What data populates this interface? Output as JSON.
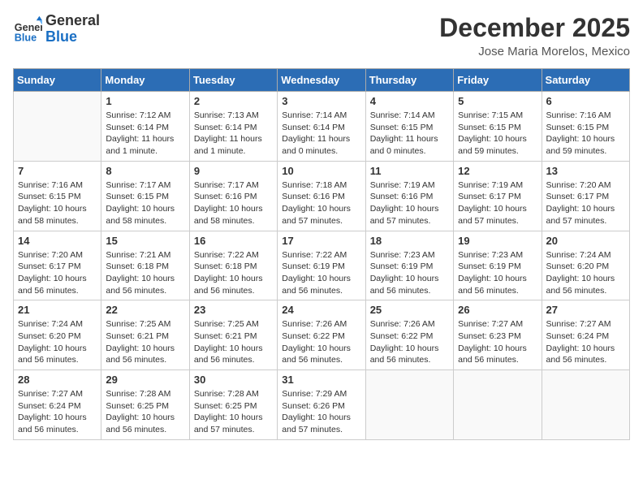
{
  "header": {
    "logo_general": "General",
    "logo_blue": "Blue",
    "month_title": "December 2025",
    "location": "Jose Maria Morelos, Mexico"
  },
  "columns": [
    "Sunday",
    "Monday",
    "Tuesday",
    "Wednesday",
    "Thursday",
    "Friday",
    "Saturday"
  ],
  "weeks": [
    [
      {
        "day": "",
        "info": ""
      },
      {
        "day": "1",
        "info": "Sunrise: 7:12 AM\nSunset: 6:14 PM\nDaylight: 11 hours and 1 minute."
      },
      {
        "day": "2",
        "info": "Sunrise: 7:13 AM\nSunset: 6:14 PM\nDaylight: 11 hours and 1 minute."
      },
      {
        "day": "3",
        "info": "Sunrise: 7:14 AM\nSunset: 6:14 PM\nDaylight: 11 hours and 0 minutes."
      },
      {
        "day": "4",
        "info": "Sunrise: 7:14 AM\nSunset: 6:15 PM\nDaylight: 11 hours and 0 minutes."
      },
      {
        "day": "5",
        "info": "Sunrise: 7:15 AM\nSunset: 6:15 PM\nDaylight: 10 hours and 59 minutes."
      },
      {
        "day": "6",
        "info": "Sunrise: 7:16 AM\nSunset: 6:15 PM\nDaylight: 10 hours and 59 minutes."
      }
    ],
    [
      {
        "day": "7",
        "info": "Sunrise: 7:16 AM\nSunset: 6:15 PM\nDaylight: 10 hours and 58 minutes."
      },
      {
        "day": "8",
        "info": "Sunrise: 7:17 AM\nSunset: 6:15 PM\nDaylight: 10 hours and 58 minutes."
      },
      {
        "day": "9",
        "info": "Sunrise: 7:17 AM\nSunset: 6:16 PM\nDaylight: 10 hours and 58 minutes."
      },
      {
        "day": "10",
        "info": "Sunrise: 7:18 AM\nSunset: 6:16 PM\nDaylight: 10 hours and 57 minutes."
      },
      {
        "day": "11",
        "info": "Sunrise: 7:19 AM\nSunset: 6:16 PM\nDaylight: 10 hours and 57 minutes."
      },
      {
        "day": "12",
        "info": "Sunrise: 7:19 AM\nSunset: 6:17 PM\nDaylight: 10 hours and 57 minutes."
      },
      {
        "day": "13",
        "info": "Sunrise: 7:20 AM\nSunset: 6:17 PM\nDaylight: 10 hours and 57 minutes."
      }
    ],
    [
      {
        "day": "14",
        "info": "Sunrise: 7:20 AM\nSunset: 6:17 PM\nDaylight: 10 hours and 56 minutes."
      },
      {
        "day": "15",
        "info": "Sunrise: 7:21 AM\nSunset: 6:18 PM\nDaylight: 10 hours and 56 minutes."
      },
      {
        "day": "16",
        "info": "Sunrise: 7:22 AM\nSunset: 6:18 PM\nDaylight: 10 hours and 56 minutes."
      },
      {
        "day": "17",
        "info": "Sunrise: 7:22 AM\nSunset: 6:19 PM\nDaylight: 10 hours and 56 minutes."
      },
      {
        "day": "18",
        "info": "Sunrise: 7:23 AM\nSunset: 6:19 PM\nDaylight: 10 hours and 56 minutes."
      },
      {
        "day": "19",
        "info": "Sunrise: 7:23 AM\nSunset: 6:19 PM\nDaylight: 10 hours and 56 minutes."
      },
      {
        "day": "20",
        "info": "Sunrise: 7:24 AM\nSunset: 6:20 PM\nDaylight: 10 hours and 56 minutes."
      }
    ],
    [
      {
        "day": "21",
        "info": "Sunrise: 7:24 AM\nSunset: 6:20 PM\nDaylight: 10 hours and 56 minutes."
      },
      {
        "day": "22",
        "info": "Sunrise: 7:25 AM\nSunset: 6:21 PM\nDaylight: 10 hours and 56 minutes."
      },
      {
        "day": "23",
        "info": "Sunrise: 7:25 AM\nSunset: 6:21 PM\nDaylight: 10 hours and 56 minutes."
      },
      {
        "day": "24",
        "info": "Sunrise: 7:26 AM\nSunset: 6:22 PM\nDaylight: 10 hours and 56 minutes."
      },
      {
        "day": "25",
        "info": "Sunrise: 7:26 AM\nSunset: 6:22 PM\nDaylight: 10 hours and 56 minutes."
      },
      {
        "day": "26",
        "info": "Sunrise: 7:27 AM\nSunset: 6:23 PM\nDaylight: 10 hours and 56 minutes."
      },
      {
        "day": "27",
        "info": "Sunrise: 7:27 AM\nSunset: 6:24 PM\nDaylight: 10 hours and 56 minutes."
      }
    ],
    [
      {
        "day": "28",
        "info": "Sunrise: 7:27 AM\nSunset: 6:24 PM\nDaylight: 10 hours and 56 minutes."
      },
      {
        "day": "29",
        "info": "Sunrise: 7:28 AM\nSunset: 6:25 PM\nDaylight: 10 hours and 56 minutes."
      },
      {
        "day": "30",
        "info": "Sunrise: 7:28 AM\nSunset: 6:25 PM\nDaylight: 10 hours and 57 minutes."
      },
      {
        "day": "31",
        "info": "Sunrise: 7:29 AM\nSunset: 6:26 PM\nDaylight: 10 hours and 57 minutes."
      },
      {
        "day": "",
        "info": ""
      },
      {
        "day": "",
        "info": ""
      },
      {
        "day": "",
        "info": ""
      }
    ]
  ]
}
